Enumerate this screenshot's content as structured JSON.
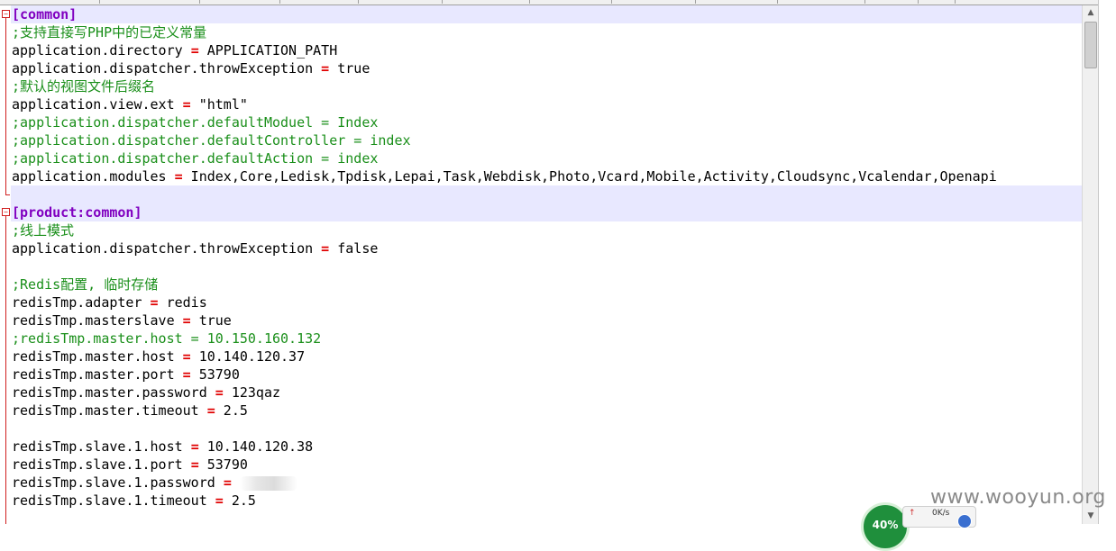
{
  "editor": {
    "lines": [
      [
        {
          "t": "[common]",
          "c": "section"
        }
      ],
      [
        {
          "t": ";支持直接写PHP中的已定义常量",
          "c": "comment"
        }
      ],
      [
        {
          "t": "application.directory "
        },
        {
          "t": "=",
          "c": "op"
        },
        {
          "t": " APPLICATION_PATH"
        }
      ],
      [
        {
          "t": "application.dispatcher.throwException "
        },
        {
          "t": "=",
          "c": "op"
        },
        {
          "t": " true"
        }
      ],
      [
        {
          "t": ";默认的视图文件后缀名",
          "c": "comment"
        }
      ],
      [
        {
          "t": "application.view.ext "
        },
        {
          "t": "=",
          "c": "op"
        },
        {
          "t": " \"html\""
        }
      ],
      [
        {
          "t": ";application.dispatcher.defaultModuel = Index",
          "c": "comment"
        }
      ],
      [
        {
          "t": ";application.dispatcher.defaultController = index",
          "c": "comment"
        }
      ],
      [
        {
          "t": ";application.dispatcher.defaultAction = index",
          "c": "comment"
        }
      ],
      [
        {
          "t": "application.modules "
        },
        {
          "t": "=",
          "c": "op"
        },
        {
          "t": " Index,Core,Ledisk,Tpdisk,Lepai,Task,Webdisk,Photo,Vcard,Mobile,Activity,Cloudsync,Vcalendar,Openapi"
        }
      ],
      [],
      [
        {
          "t": "[product:common]",
          "c": "section"
        }
      ],
      [
        {
          "t": ";线上模式",
          "c": "comment"
        }
      ],
      [
        {
          "t": "application.dispatcher.throwException "
        },
        {
          "t": "=",
          "c": "op"
        },
        {
          "t": " false"
        }
      ],
      [],
      [
        {
          "t": ";Redis配置, 临时存储",
          "c": "comment"
        }
      ],
      [
        {
          "t": "redisTmp.adapter "
        },
        {
          "t": "=",
          "c": "op"
        },
        {
          "t": " redis"
        }
      ],
      [
        {
          "t": "redisTmp.masterslave "
        },
        {
          "t": "=",
          "c": "op"
        },
        {
          "t": " true"
        }
      ],
      [
        {
          "t": ";redisTmp.master.host = 10.150.160.132",
          "c": "comment"
        }
      ],
      [
        {
          "t": "redisTmp.master.host "
        },
        {
          "t": "=",
          "c": "op"
        },
        {
          "t": " 10.140.120.37"
        }
      ],
      [
        {
          "t": "redisTmp.master.port "
        },
        {
          "t": "=",
          "c": "op"
        },
        {
          "t": " 53790"
        }
      ],
      [
        {
          "t": "redisTmp.master.password "
        },
        {
          "t": "=",
          "c": "op"
        },
        {
          "t": " 123qaz"
        }
      ],
      [
        {
          "t": "redisTmp.master.timeout "
        },
        {
          "t": "=",
          "c": "op"
        },
        {
          "t": " 2.5"
        }
      ],
      [],
      [
        {
          "t": "redisTmp.slave.1.host "
        },
        {
          "t": "=",
          "c": "op"
        },
        {
          "t": " 10.140.120.38"
        }
      ],
      [
        {
          "t": "redisTmp.slave.1.port "
        },
        {
          "t": "=",
          "c": "op"
        },
        {
          "t": " 53790"
        }
      ],
      [
        {
          "t": "redisTmp.slave.1.password "
        },
        {
          "t": "=",
          "c": "op"
        },
        {
          "t": " "
        },
        {
          "t": "",
          "c": "masked"
        }
      ],
      [
        {
          "t": "redisTmp.slave.1.timeout "
        },
        {
          "t": "=",
          "c": "op"
        },
        {
          "t": " 2.5"
        }
      ]
    ],
    "highlighted_lines": [
      0,
      10,
      11
    ]
  },
  "watermark": "www.wooyun.org",
  "speed_widget": {
    "percent": "40%",
    "arrow": "↑",
    "rate": "0K/s"
  },
  "scrollbar": {
    "up_arrow": "▲",
    "down_arrow": "▼"
  },
  "fold_markers": {
    "collapse_glyph": "−"
  }
}
